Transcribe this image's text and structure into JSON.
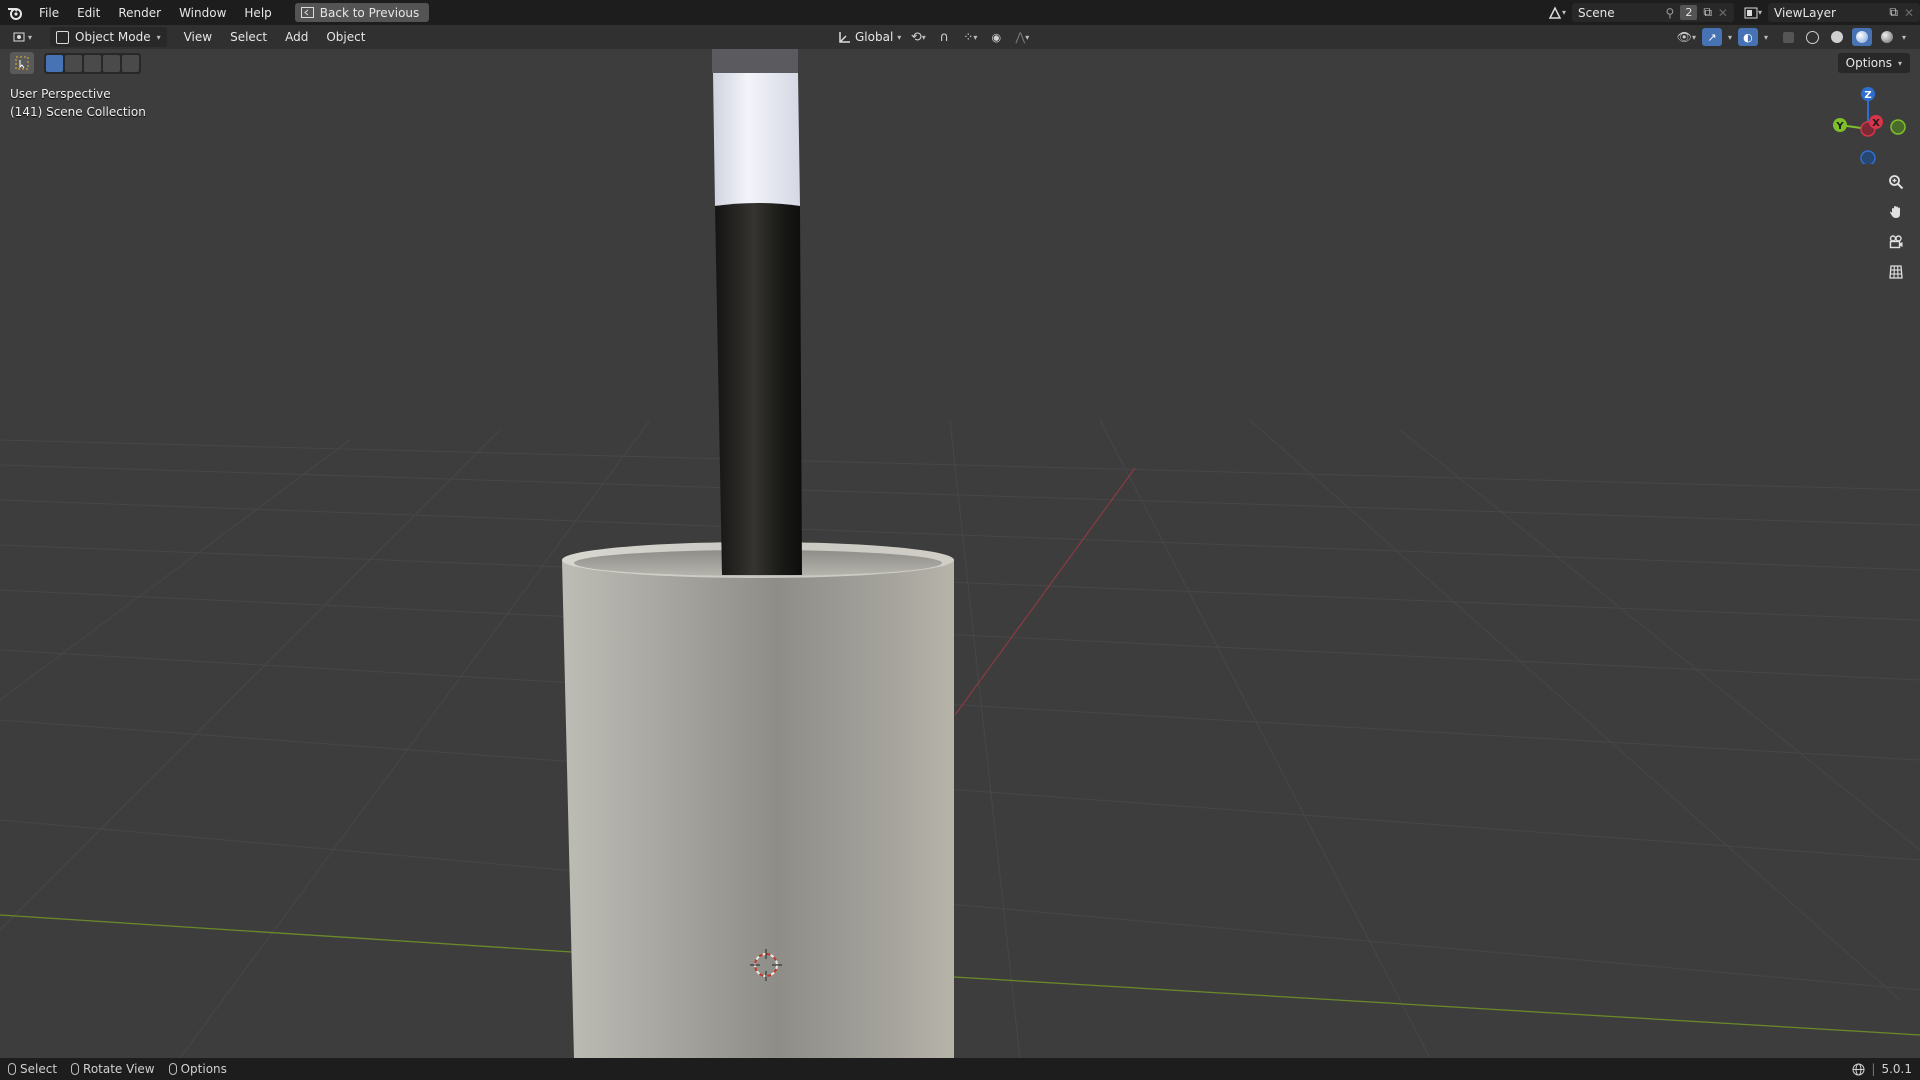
{
  "topbar": {
    "menus": [
      "File",
      "Edit",
      "Render",
      "Window",
      "Help"
    ],
    "back_label": "Back to Previous",
    "scene_label": "Scene",
    "scene_count": "2",
    "view_layer_label": "ViewLayer"
  },
  "header": {
    "mode_label": "Object Mode",
    "menus": [
      "View",
      "Select",
      "Add",
      "Object"
    ],
    "orientation_label": "Global"
  },
  "viewport": {
    "view_name": "User Perspective",
    "collection_label": "(141) Scene Collection",
    "options_label": "Options"
  },
  "gizmo": {
    "x_label": "X",
    "y_label": "Y",
    "z_label": "Z",
    "x_color": "#d9344a",
    "y_color": "#7fbf2a",
    "z_color": "#2d6fd1"
  },
  "statusbar": {
    "select_label": "Select",
    "rotate_label": "Rotate View",
    "options_label": "Options",
    "version": "5.0.1"
  },
  "icons": [
    "blender-logo-icon",
    "back-icon",
    "scene-icon",
    "pin-icon",
    "new-scene-icon",
    "view-layer-icon",
    "editor-type-icon",
    "object-mode-icon",
    "orientation-icon",
    "pivot-icon",
    "snap-icon",
    "proportional-icon",
    "visibility-icon",
    "gizmo-icon",
    "overlay-icon",
    "xray-icon",
    "wireframe-shading-icon",
    "solid-shading-icon",
    "material-shading-icon",
    "rendered-shading-icon",
    "select-tool-icon",
    "zoom-icon",
    "hand-pan-icon",
    "camera-icon",
    "grid-ortho-icon",
    "globe-icon"
  ]
}
